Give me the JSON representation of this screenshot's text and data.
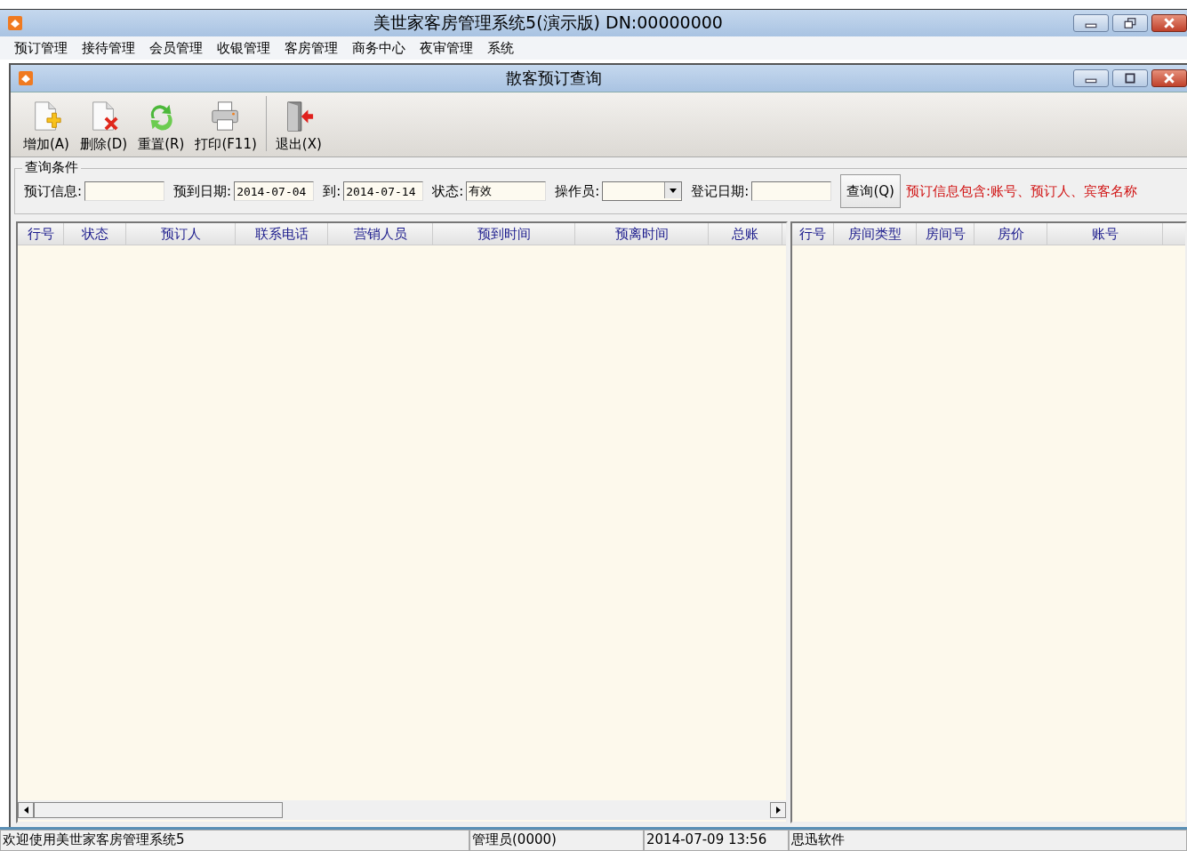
{
  "window": {
    "title": "美世家客房管理系统5(演示版) DN:00000000"
  },
  "menu": [
    "预订管理",
    "接待管理",
    "会员管理",
    "收银管理",
    "客房管理",
    "商务中心",
    "夜审管理",
    "系统"
  ],
  "child_window": {
    "title": "散客预订查询"
  },
  "toolbar": [
    {
      "label": "增加(A)",
      "kind": "add"
    },
    {
      "label": "删除(D)",
      "kind": "delete"
    },
    {
      "label": "重置(R)",
      "kind": "reset"
    },
    {
      "label": "打印(F11)",
      "kind": "print"
    },
    {
      "label": "退出(X)",
      "kind": "exit"
    }
  ],
  "query": {
    "title": "查询条件",
    "fields": [
      {
        "label": "预订信息:",
        "kind": "text"
      },
      {
        "label": "预到日期:",
        "kind": "text",
        "value": "2014-07-04"
      },
      {
        "label": "到:",
        "kind": "text",
        "value": "2014-07-14"
      },
      {
        "label": "状态:",
        "kind": "text",
        "value": "有效"
      },
      {
        "label": "操作员:",
        "kind": "combo"
      },
      {
        "label": "登记日期:",
        "kind": "text"
      }
    ],
    "button": "查询(Q)",
    "hint": "预订信息包含:账号、预订人、宾客名称"
  },
  "bookings_table": {
    "columns": [
      "行号",
      "状态",
      "预订人",
      "联系电话",
      "营销人员",
      "预到时间",
      "预离时间",
      "总账"
    ]
  },
  "rooms_table": {
    "columns": [
      "行号",
      "房间类型",
      "房间号",
      "房价",
      "账号"
    ]
  },
  "status_bar": [
    "欢迎使用美世家客房管理系统5",
    "管理员(0000)",
    "2014-07-09 13:56",
    "思迅软件"
  ]
}
